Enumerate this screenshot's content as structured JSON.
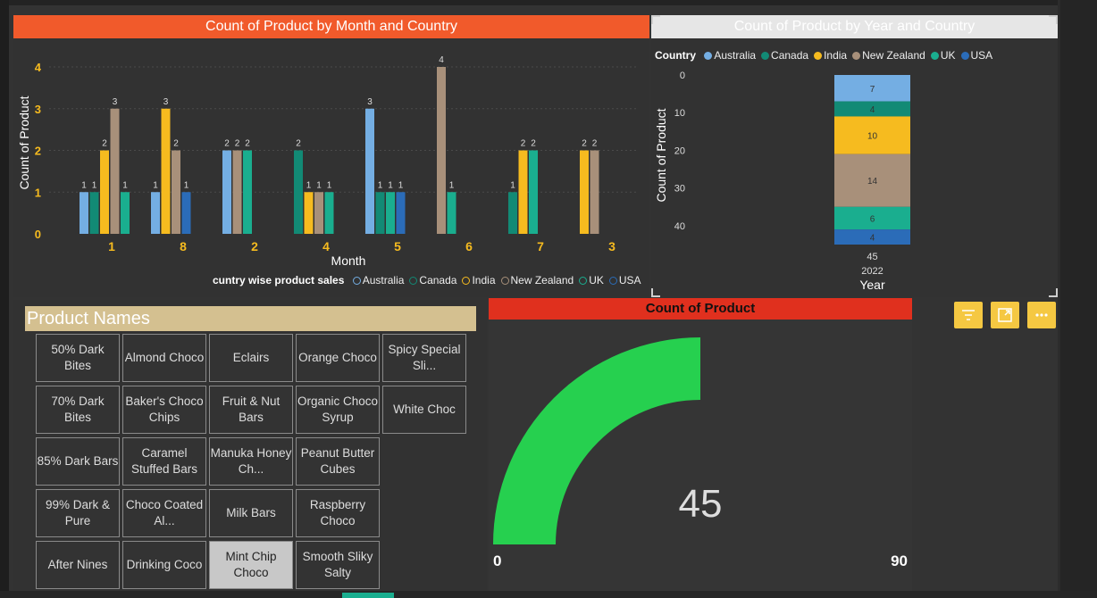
{
  "bar_chart": {
    "title": "Count of Product by Month and Country",
    "chart_data": {
      "type": "bar",
      "xlabel": "Month",
      "ylabel": "Count of Product",
      "ylim": [
        0,
        4
      ],
      "yticks": [
        "0",
        "1",
        "2",
        "3",
        "4"
      ],
      "categories": [
        "1",
        "8",
        "2",
        "4",
        "5",
        "6",
        "7",
        "3"
      ],
      "legend_title": "cuntry wise product sales",
      "series": [
        {
          "name": "Australia",
          "color": "#74aee3",
          "values": [
            1,
            1,
            2,
            null,
            3,
            null,
            null,
            null
          ]
        },
        {
          "name": "Canada",
          "color": "#128a75",
          "values": [
            1,
            null,
            null,
            2,
            1,
            null,
            1,
            null
          ]
        },
        {
          "name": "India",
          "color": "#f6bb1f",
          "values": [
            2,
            3,
            null,
            1,
            null,
            null,
            2,
            2
          ]
        },
        {
          "name": "New Zealand",
          "color": "#a8907a",
          "values": [
            3,
            2,
            2,
            1,
            null,
            4,
            null,
            2
          ]
        },
        {
          "name": "UK",
          "color": "#1aae8f",
          "values": [
            1,
            null,
            2,
            1,
            1,
            1,
            2,
            null
          ]
        },
        {
          "name": "USA",
          "color": "#2b6cb8",
          "values": [
            null,
            1,
            null,
            null,
            1,
            null,
            null,
            null
          ]
        }
      ]
    }
  },
  "stacked_chart": {
    "title": "Count of Product by Year and Country",
    "legend_title": "Country",
    "chart_data": {
      "type": "bar",
      "xlabel": "Year",
      "ylabel": "Count of Product",
      "ylim": [
        0,
        45
      ],
      "yticks": [
        "0",
        "10",
        "20",
        "30",
        "40"
      ],
      "categories": [
        "2022"
      ],
      "total_label": "45",
      "series": [
        {
          "name": "Australia",
          "color": "#74aee3",
          "values": [
            7
          ]
        },
        {
          "name": "Canada",
          "color": "#128a75",
          "values": [
            4
          ]
        },
        {
          "name": "India",
          "color": "#f6bb1f",
          "values": [
            10
          ]
        },
        {
          "name": "New Zealand",
          "color": "#a8907a",
          "values": [
            14
          ]
        },
        {
          "name": "UK",
          "color": "#1aae8f",
          "values": [
            6
          ]
        },
        {
          "name": "USA",
          "color": "#2b6cb8",
          "values": [
            4
          ]
        }
      ]
    }
  },
  "slicer": {
    "title": "Product Names",
    "tiles": [
      "50% Dark Bites",
      "Almond Choco",
      "Eclairs",
      "Orange Choco",
      "Spicy Special Sli...",
      "70% Dark Bites",
      "Baker's Choco Chips",
      "Fruit & Nut Bars",
      "Organic Choco Syrup",
      "White Choc",
      "85% Dark Bars",
      "Caramel Stuffed Bars",
      "Manuka Honey Ch...",
      "Peanut Butter Cubes",
      "99% Dark & Pure",
      "Choco Coated Al...",
      "Milk Bars",
      "Raspberry Choco",
      "After Nines",
      "Drinking Coco",
      "Mint Chip Choco",
      "Smooth Sliky Salty"
    ],
    "selected": "Mint Chip Choco"
  },
  "gauge": {
    "title": "Count of Product",
    "chart_data": {
      "type": "gauge",
      "value": 45,
      "min": 0,
      "max": 90
    },
    "value_label": "45",
    "min_label": "0",
    "max_label": "90",
    "color": "#26d04f"
  },
  "toolbar": {
    "icons": [
      "filter-icon",
      "focus-mode-icon",
      "more-options-icon"
    ],
    "color": "#f5c842"
  }
}
